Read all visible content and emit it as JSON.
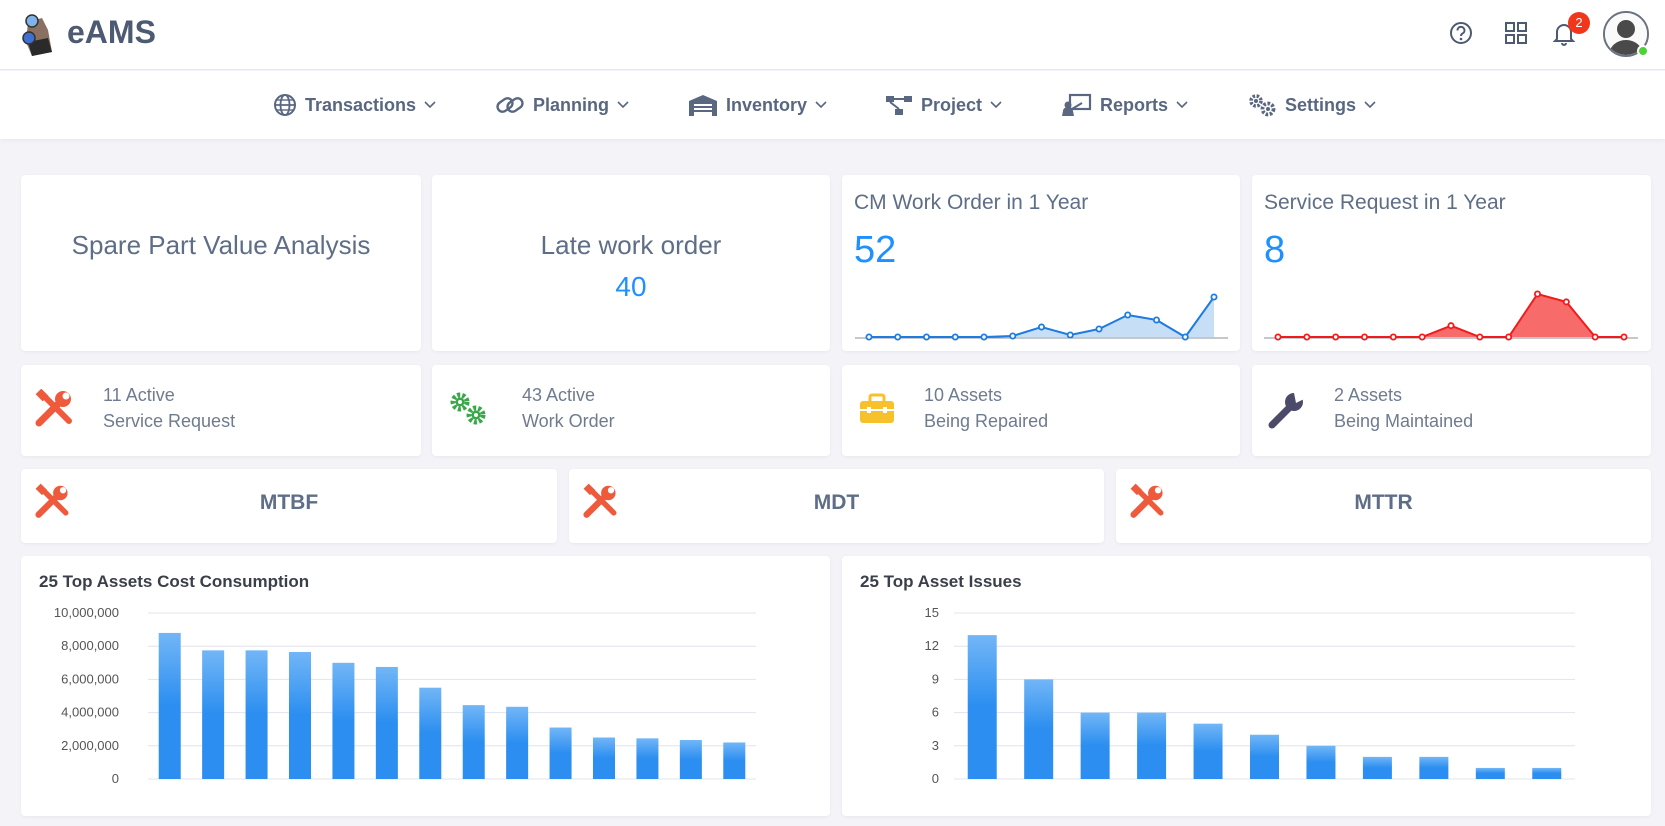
{
  "app": {
    "brand": "eAMS",
    "notification_count": "2"
  },
  "nav": [
    {
      "label": "Transactions",
      "icon": "globe-icon"
    },
    {
      "label": "Planning",
      "icon": "link-icon"
    },
    {
      "label": "Inventory",
      "icon": "warehouse-icon"
    },
    {
      "label": "Project",
      "icon": "sitemap-icon"
    },
    {
      "label": "Reports",
      "icon": "presentation-icon"
    },
    {
      "label": "Settings",
      "icon": "gears-icon"
    }
  ],
  "summary": {
    "spare_part": {
      "title": "Spare Part Value Analysis"
    },
    "late_work_order": {
      "title": "Late work order",
      "value": "40"
    },
    "cm_work_order": {
      "title": "CM Work Order in 1 Year",
      "value": "52",
      "color": "#1e7be0",
      "points": [
        0,
        0,
        0,
        0,
        0,
        0.1,
        1,
        0.2,
        0.8,
        2.2,
        1.7,
        0,
        4
      ]
    },
    "service_request": {
      "title": "Service Request in 1 Year",
      "value": "8",
      "color": "#f21b1b",
      "points": [
        0,
        0,
        0,
        0,
        0,
        0,
        1,
        0,
        0,
        3.8,
        3.1,
        0,
        0
      ]
    }
  },
  "stats": [
    {
      "line1": "11 Active",
      "line2": "Service Request",
      "icon": "tools-icon",
      "color": "#ef5a3c"
    },
    {
      "line1": "43 Active",
      "line2": "Work Order",
      "icon": "gears-icon",
      "color": "#38a84a"
    },
    {
      "line1": "10 Assets",
      "line2": "Being Repaired",
      "icon": "toolbox-icon",
      "color": "#f7c12c"
    },
    {
      "line1": "2 Assets",
      "line2": "Being Maintained",
      "icon": "wrench-icon",
      "color": "#4c4a6a"
    }
  ],
  "metrics": [
    {
      "label": "MTBF",
      "icon": "tools-icon"
    },
    {
      "label": "MDT",
      "icon": "tools-icon"
    },
    {
      "label": "MTTR",
      "icon": "tools-icon"
    }
  ],
  "chart_data": [
    {
      "type": "bar",
      "title": "25 Top Assets Cost Consumption",
      "ylim": [
        0,
        10000000
      ],
      "yticks": [
        "0",
        "2,000,000",
        "4,000,000",
        "6,000,000",
        "8,000,000",
        "10,000,000"
      ],
      "values": [
        8800000,
        7750000,
        7750000,
        7650000,
        7000000,
        6750000,
        5500000,
        4450000,
        4350000,
        3100000,
        2500000,
        2450000,
        2350000,
        2200000
      ],
      "grid": true,
      "color": "#2b8ef0"
    },
    {
      "type": "bar",
      "title": "25 Top Asset Issues",
      "ylim": [
        0,
        15
      ],
      "yticks": [
        "0",
        "3",
        "6",
        "9",
        "12",
        "15"
      ],
      "values": [
        13,
        9,
        6,
        6,
        5,
        4,
        3,
        2,
        2,
        1,
        1
      ],
      "grid": true,
      "color": "#2b8ef0"
    }
  ]
}
